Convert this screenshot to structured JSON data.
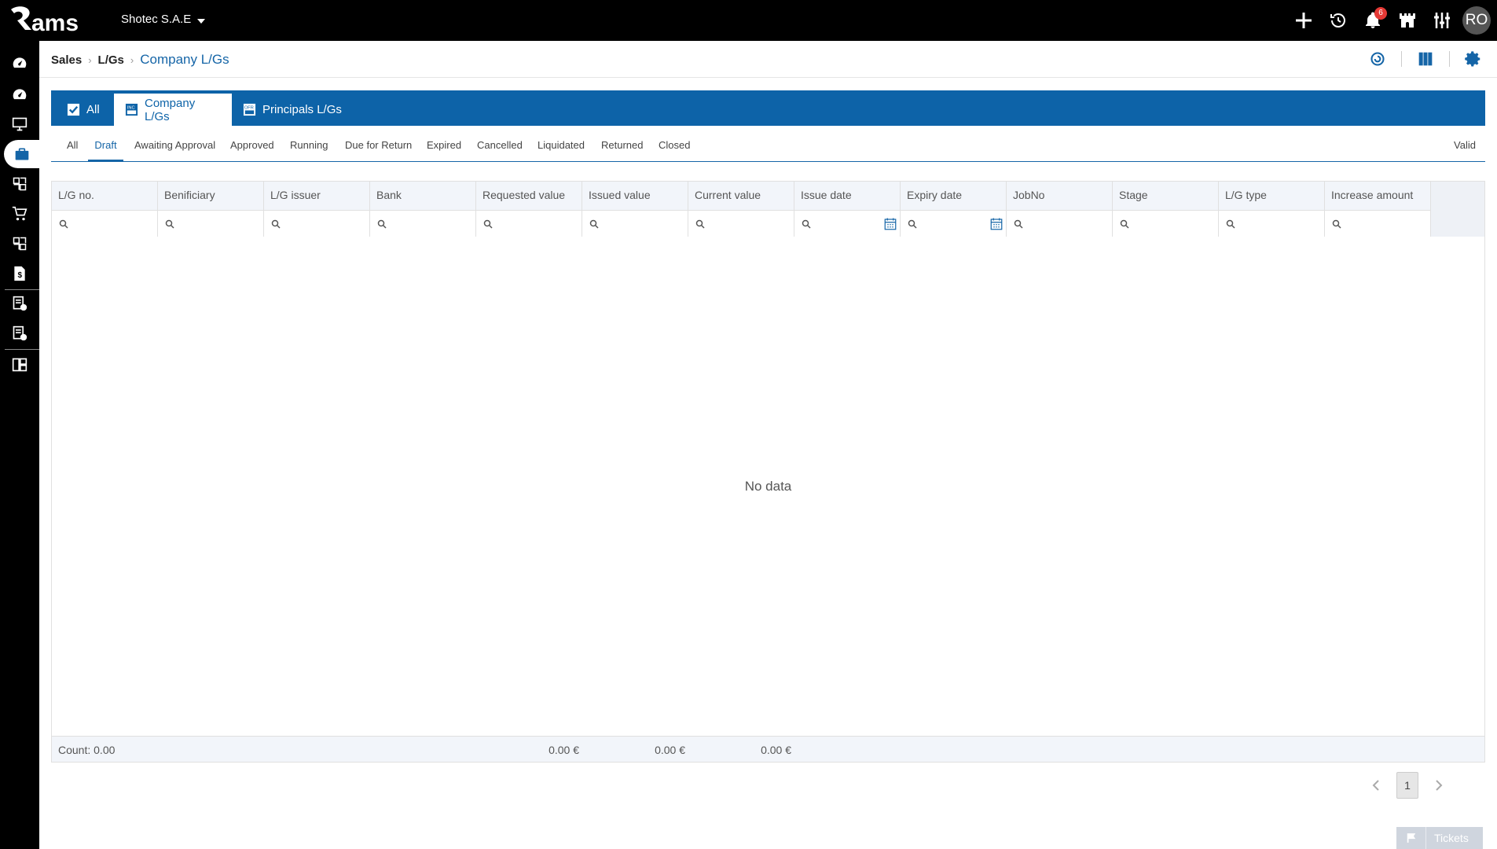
{
  "app": {
    "company": "Shotec S.A.E",
    "user_initials": "RO",
    "notification_count": "6"
  },
  "icons": {
    "add": "plus-icon",
    "history": "history-icon",
    "notifications": "bell-icon",
    "store": "castle-icon",
    "tools": "sliders-icon"
  },
  "breadcrumb": {
    "items": [
      "Sales",
      "L/Gs"
    ],
    "current": "Company L/Gs"
  },
  "main_tabs": [
    {
      "label": "All",
      "active": false
    },
    {
      "label": "Company L/Gs",
      "active": true
    },
    {
      "label": "Principals L/Gs",
      "active": false
    }
  ],
  "status_tabs": [
    "All",
    "Draft",
    "Awaiting Approval",
    "Approved",
    "Running",
    "Due for Return",
    "Expired",
    "Cancelled",
    "Liquidated",
    "Returned",
    "Closed"
  ],
  "status_active": "Draft",
  "right_tab": "Valid",
  "table": {
    "columns": [
      "L/G no.",
      "Benificiary",
      "L/G issuer",
      "Bank",
      "Requested value",
      "Issued value",
      "Current value",
      "Issue date",
      "Expiry date",
      "JobNo",
      "Stage",
      "L/G type",
      "Increase amount"
    ],
    "empty_text": "No data"
  },
  "summary": {
    "count": "Count: 0.00",
    "requested": "0.00 €",
    "issued": "0.00 €",
    "current": "0.00 €"
  },
  "pagination": {
    "page": "1"
  },
  "tickets": {
    "label": "Tickets"
  },
  "colors": {
    "primary": "#0d63a8",
    "topbar": "#000000",
    "badge": "#e53935"
  }
}
